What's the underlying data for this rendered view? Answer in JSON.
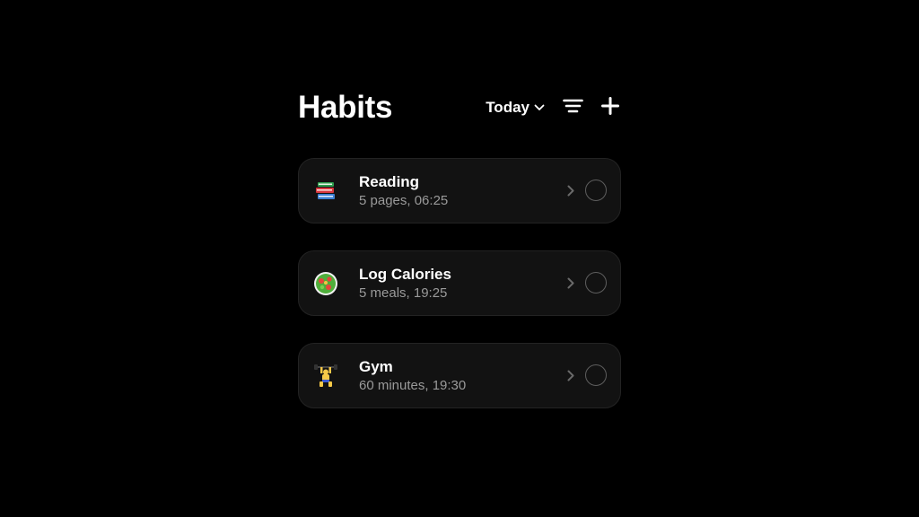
{
  "header": {
    "title": "Habits",
    "period_selector": {
      "selected": "Today",
      "icon": "chevron-down-icon"
    },
    "sort_icon": "sort-icon",
    "add_icon": "plus-icon"
  },
  "habits": [
    {
      "icon": "books-icon",
      "name": "Reading",
      "detail": "5 pages, 06:25"
    },
    {
      "icon": "salad-icon",
      "name": "Log Calories",
      "detail": "5 meals, 19:25"
    },
    {
      "icon": "weightlifter-icon",
      "name": "Gym",
      "detail": "60 minutes, 19:30"
    }
  ],
  "colors": {
    "background": "#000000",
    "card": "#121212",
    "card_border": "#232323",
    "text_primary": "#ffffff",
    "text_secondary": "#9a9a9a",
    "checkbox_border": "#5e5e5e"
  }
}
